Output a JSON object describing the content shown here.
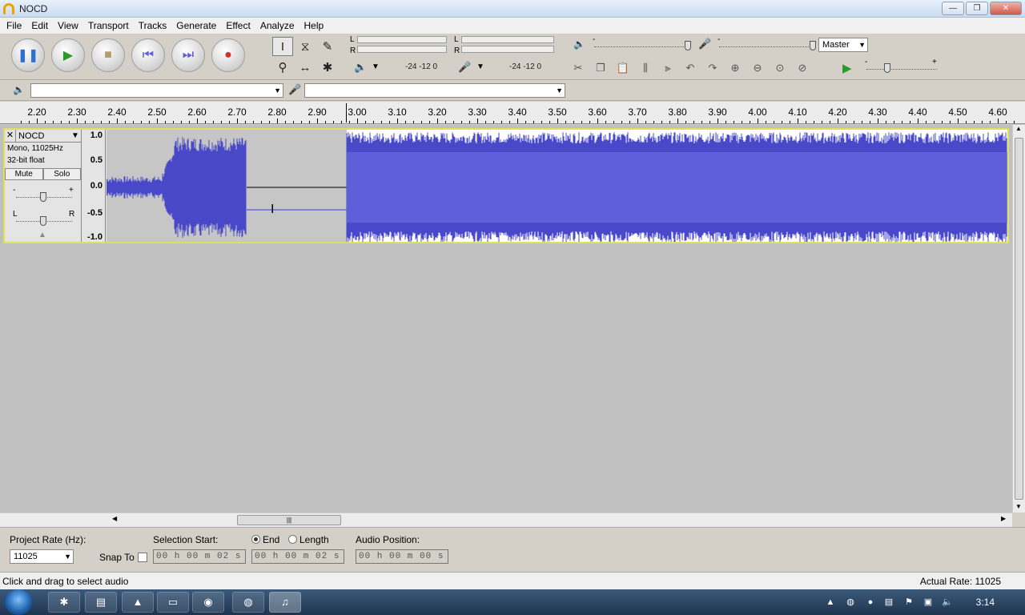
{
  "window": {
    "title": "NOCD",
    "minimize": "—",
    "maximize": "❐",
    "close": "✕"
  },
  "menu": [
    "File",
    "Edit",
    "View",
    "Transport",
    "Tracks",
    "Generate",
    "Effect",
    "Analyze",
    "Help"
  ],
  "transport": {
    "pause": "❚❚",
    "play": "▶",
    "stop": "■",
    "skip_start": "⏮",
    "skip_end": "⏭",
    "record": "●"
  },
  "tools": {
    "select": "I",
    "envelope": "⧖",
    "draw": "✎",
    "zoom": "⚲",
    "timeshift": "↔",
    "multi": "✱"
  },
  "meters": {
    "play_L": "L",
    "play_R": "R",
    "rec_L": "L",
    "rec_R": "R",
    "play_scale": "-24  -12   0",
    "rec_scale": "-24  -12   0",
    "speaker_icon": "🔈",
    "mic_icon": "🎤"
  },
  "mixer": {
    "minus": "-",
    "plus": "+",
    "source": "Master"
  },
  "ruler": {
    "ticks": [
      "2.20",
      "2.30",
      "2.40",
      "2.50",
      "2.60",
      "2.70",
      "2.80",
      "2.90",
      "3.00",
      "3.10",
      "3.20",
      "3.30",
      "3.40",
      "3.50",
      "3.60",
      "3.70",
      "3.80",
      "3.90",
      "4.00",
      "4.10",
      "4.20",
      "4.30",
      "4.40",
      "4.50",
      "4.60"
    ]
  },
  "track": {
    "name": "NOCD",
    "close": "✕",
    "info_line1": "Mono, 11025Hz",
    "info_line2": "32-bit float",
    "mute": "Mute",
    "solo": "Solo",
    "gain_minus": "-",
    "gain_plus": "+",
    "pan_left": "L",
    "pan_right": "R",
    "scale": [
      "1.0",
      "0.5",
      "0.0",
      "-0.5",
      "-1.0"
    ]
  },
  "selection": {
    "project_rate_label": "Project Rate (Hz):",
    "project_rate": "11025",
    "snap_to": "Snap To",
    "selection_start_label": "Selection Start:",
    "end_label": "End",
    "length_label": "Length",
    "audio_position_label": "Audio Position:",
    "start_time": "00 h 00 m 02 s",
    "end_time": "00 h 00 m 02 s",
    "audio_position": "00 h 00 m 00 s"
  },
  "status": {
    "message": "Click and drag to select audio",
    "actual_rate": "Actual Rate: 11025"
  },
  "taskbar": {
    "clock": "3:14"
  },
  "colors": {
    "waveform": "#4848c8",
    "waveform_light": "#6a6ae0",
    "track_border": "#e0e060",
    "background": "#c0c0c0"
  }
}
